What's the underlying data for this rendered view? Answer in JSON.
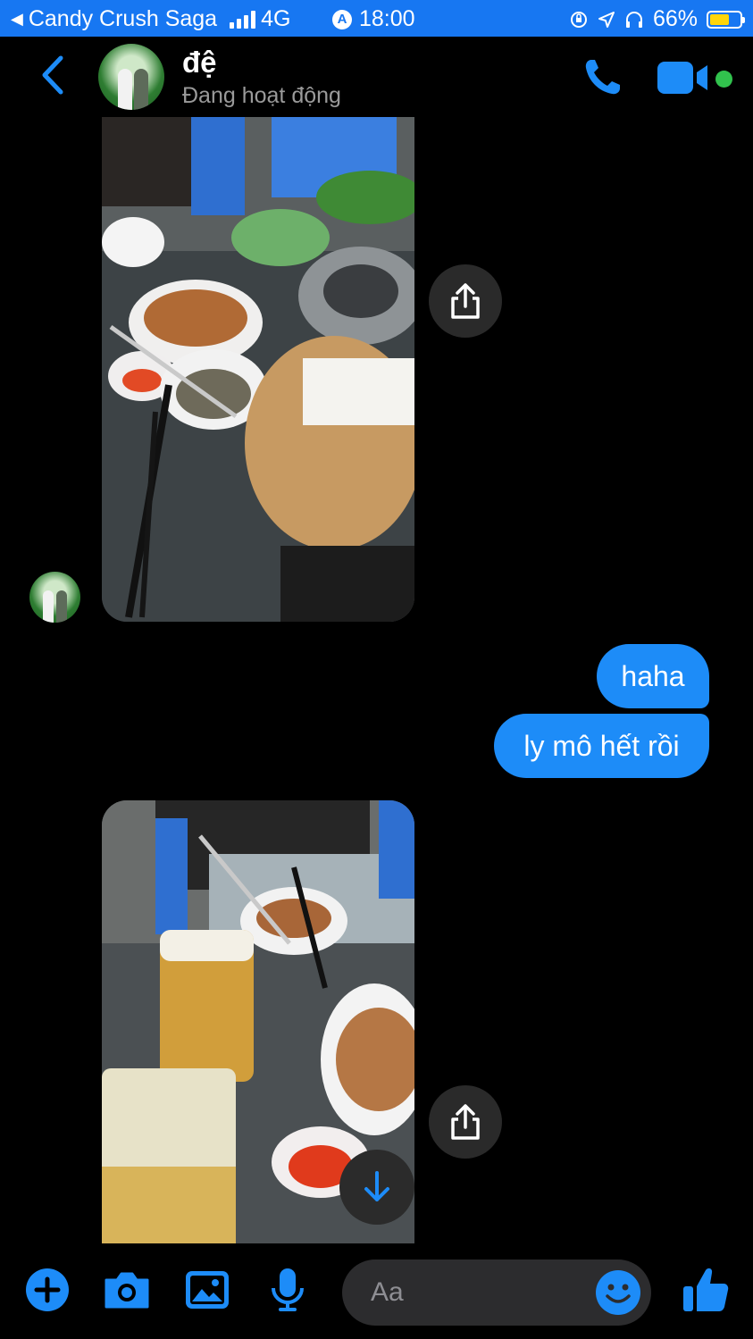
{
  "status_bar": {
    "back_app": "Candy Crush Saga",
    "network": "4G",
    "time": "18:00",
    "battery": "66%",
    "battery_level": 0.66
  },
  "header": {
    "contact_name": "đệ",
    "presence": "Đang hoạt động",
    "icons": [
      "back-chevron-icon",
      "phone-icon",
      "video-camera-icon",
      "online-dot"
    ]
  },
  "messages": [
    {
      "type": "photo",
      "from": "contact",
      "description_icon": "share-icon"
    },
    {
      "type": "text",
      "from": "me",
      "text": "haha"
    },
    {
      "type": "text",
      "from": "me",
      "text": "ly mô hết rồi"
    },
    {
      "type": "photo",
      "from": "contact",
      "description_icon": "share-icon"
    }
  ],
  "composer": {
    "placeholder": "Aa",
    "tools": [
      "plus-icon",
      "camera-icon",
      "gallery-icon",
      "microphone-icon",
      "emoji-icon",
      "thumbs-up-icon"
    ]
  },
  "colors": {
    "accent": "#1d8cf8",
    "status_bar": "#1777f2",
    "online": "#31c24d"
  }
}
